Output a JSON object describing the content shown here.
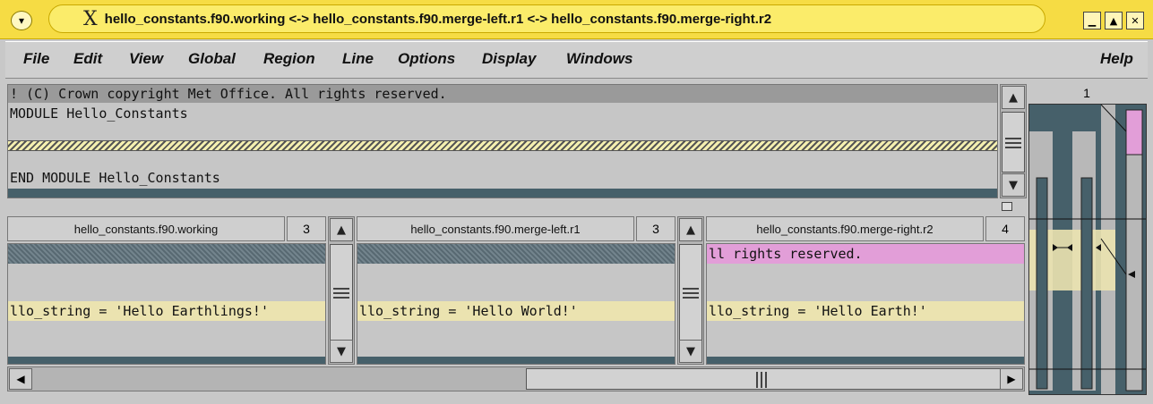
{
  "window": {
    "title": "hello_constants.f90.working <-> hello_constants.f90.merge-left.r1 <-> hello_constants.f90.merge-right.r2",
    "logo_glyph": "X",
    "menu_glyph": "▾",
    "buttons": {
      "minimize": "▁",
      "maximize": "▲",
      "close": "✕"
    }
  },
  "menubar": {
    "items": [
      "File",
      "Edit",
      "View",
      "Global",
      "Region",
      "Line",
      "Options",
      "Display",
      "Windows"
    ],
    "help": "Help"
  },
  "merged": {
    "lines": [
      "! (C) Crown copyright Met Office. All rights reserved.",
      "MODULE Hello_Constants",
      "END MODULE Hello_Constants"
    ]
  },
  "overview": {
    "line_number": "1"
  },
  "panes": [
    {
      "filename": "hello_constants.f90.working",
      "number": "3",
      "text": "llo_string = 'Hello Earthlings!'"
    },
    {
      "filename": "hello_constants.f90.merge-left.r1",
      "number": "3",
      "text": "llo_string = 'Hello World!'"
    },
    {
      "filename": "hello_constants.f90.merge-right.r2",
      "number": "4",
      "text": "llo_string = 'Hello Earth!'",
      "top_text": "ll rights reserved."
    }
  ],
  "icons": {
    "up": "▲",
    "down": "▼",
    "left": "◀",
    "right": "▶"
  },
  "colors": {
    "titlebar": "#f6dc44",
    "highlight_pink": "#e29ed8",
    "highlight_yellow": "#ebe3b0",
    "dark_teal": "#46606a"
  }
}
